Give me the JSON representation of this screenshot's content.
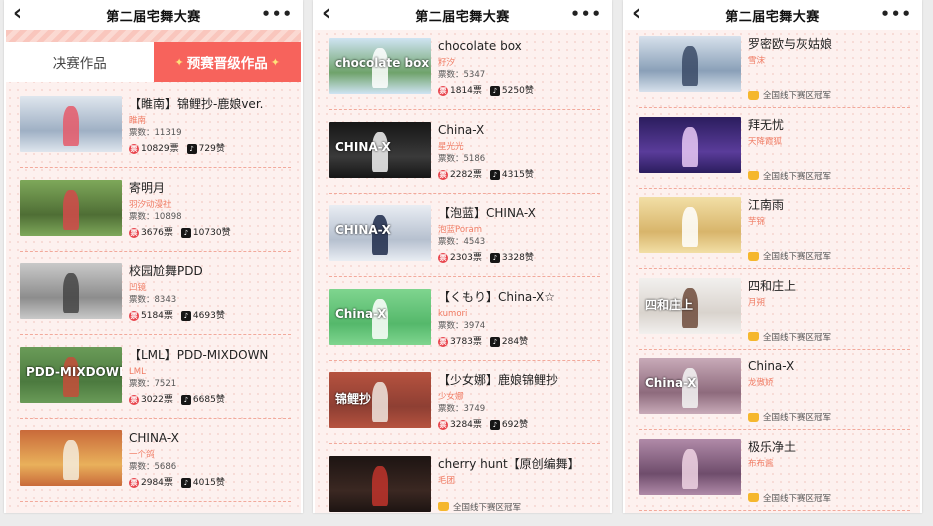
{
  "nav": {
    "title": "第二届宅舞大赛",
    "back_icon": "chevron-left-icon",
    "more_icon": "more-horizontal-icon",
    "back_glyph": "‹",
    "more_glyph": "•••"
  },
  "tabs": {
    "final": "决赛作品",
    "prelim": "预赛晋级作品"
  },
  "labels": {
    "votes_prefix": "票数：",
    "ticket_unit": "票",
    "like_unit": "赞",
    "award": "全国线下赛区冠军"
  },
  "colors": {
    "accent": "#f7635c",
    "author": "#f07b63",
    "background": "#fdf1ef",
    "crown": "#f5b72d"
  },
  "panel1": [
    {
      "title": "【睢南】锦鲤抄-鹿娘ver.",
      "author": "睢南",
      "votes": "11319",
      "tickets": "10829",
      "likes": "729",
      "palette": [
        "#dfe6ee",
        "#9fb0c4",
        "#e65a6a"
      ]
    },
    {
      "title": "寄明月",
      "author": "羽汐动漫社",
      "votes": "10898",
      "tickets": "3676",
      "likes": "10730",
      "palette": [
        "#7ea85a",
        "#4f6e35",
        "#d24a4a"
      ]
    },
    {
      "title": "校园尬舞PDD",
      "author": "凹镜",
      "votes": "8343",
      "tickets": "5184",
      "likes": "4693",
      "palette": [
        "#c9c9c9",
        "#8d8d8d",
        "#444"
      ]
    },
    {
      "title": "【LML】PDD-MIXDOWN",
      "author": "LML",
      "votes": "7521",
      "tickets": "3022",
      "likes": "6685",
      "palette": [
        "#6a9b58",
        "#4c7a3f",
        "#c44d3a"
      ],
      "overlay": "PDD-MIXDOWN"
    },
    {
      "title": "CHINA-X",
      "author": "一个鸽",
      "votes": "5686",
      "tickets": "2984",
      "likes": "4015",
      "palette": [
        "#c96a3a",
        "#e9b05b",
        "#f4ecdc"
      ]
    }
  ],
  "panel2": [
    {
      "title": "chocolate box",
      "author": "籽汐",
      "votes": "5347",
      "tickets": "1814",
      "likes": "5250",
      "palette": [
        "#cfe4f3",
        "#6fa36b",
        "#ffffff"
      ],
      "overlay": "chocolate box"
    },
    {
      "title": "China-X",
      "author": "星光光",
      "votes": "5186",
      "tickets": "2282",
      "likes": "4315",
      "palette": [
        "#161616",
        "#3a3a3a",
        "#f2f2f2"
      ],
      "overlay": "CHINA-X"
    },
    {
      "title": "【泡蓝】CHINA-X",
      "author": "泡蓝Poram",
      "votes": "4543",
      "tickets": "2303",
      "likes": "3328",
      "palette": [
        "#e9edf3",
        "#b6c0cf",
        "#1d2a4a"
      ],
      "overlay": "CHINA-X"
    },
    {
      "title": "【くもり】China-X☆",
      "author": "kumori",
      "votes": "3974",
      "tickets": "3783",
      "likes": "284",
      "palette": [
        "#7fd58f",
        "#55b86b",
        "#ffffff"
      ],
      "overlay": "China-X"
    },
    {
      "title": "【少女娜】鹿娘锦鲤抄",
      "author": "少女娜",
      "votes": "3749",
      "tickets": "3284",
      "likes": "692",
      "palette": [
        "#b6523f",
        "#8e3f33",
        "#f0e6df"
      ],
      "overlay": "锦鲤抄"
    },
    {
      "title": "cherry hunt【原创编舞】",
      "author": "毛团",
      "award": true,
      "palette": [
        "#1d1412",
        "#3b2822",
        "#c0342c"
      ]
    }
  ],
  "panel3": [
    {
      "title": "罗密欧与灰姑娘",
      "author": "雪沫",
      "award": true,
      "palette": [
        "#d7e1ec",
        "#8aa0b8",
        "#3a4a66"
      ]
    },
    {
      "title": "拜无忧",
      "author": "天降霞狐",
      "award": true,
      "palette": [
        "#2b1d5e",
        "#5a3c9a",
        "#e9c9f6"
      ]
    },
    {
      "title": "江南雨",
      "author": "芋锦",
      "award": true,
      "palette": [
        "#f2dfa6",
        "#d8b56b",
        "#ffffff"
      ]
    },
    {
      "title": "四和庄上",
      "author": "月朔",
      "award": true,
      "palette": [
        "#f2f0ee",
        "#d9d3cd",
        "#6e4b3b"
      ],
      "overlay": "四和庄上"
    },
    {
      "title": "China-X",
      "author": "龙傲娇",
      "award": true,
      "palette": [
        "#c8aab8",
        "#8e6b7d",
        "#f5f5f5"
      ],
      "overlay": "China-X"
    },
    {
      "title": "极乐净土",
      "author": "布布酱",
      "award": true,
      "palette": [
        "#b08aa8",
        "#6f4d6c",
        "#f0d4e4"
      ]
    }
  ]
}
